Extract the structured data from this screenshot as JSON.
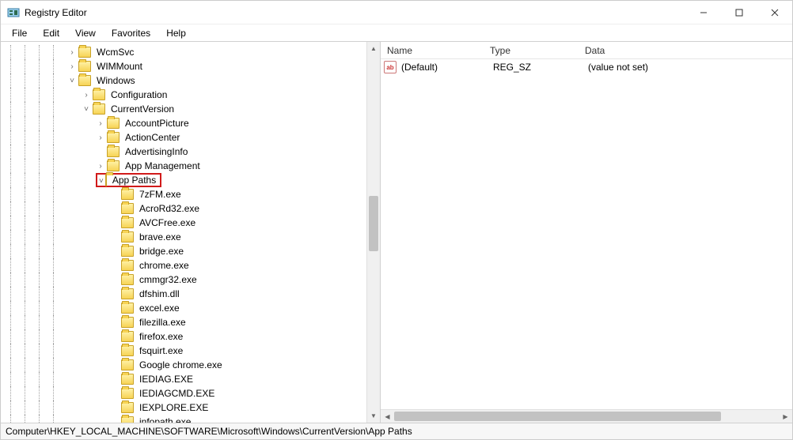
{
  "window": {
    "title": "Registry Editor"
  },
  "menu": {
    "items": [
      "File",
      "Edit",
      "View",
      "Favorites",
      "Help"
    ]
  },
  "tree": {
    "guide_offsets": [
      12,
      30,
      48,
      66
    ],
    "nodes": [
      {
        "indent": 84,
        "toggle": ">",
        "label": "WcmSvc"
      },
      {
        "indent": 84,
        "toggle": ">",
        "label": "WIMMount"
      },
      {
        "indent": 84,
        "toggle": "v",
        "label": "Windows"
      },
      {
        "indent": 102,
        "toggle": ">",
        "label": "Configuration"
      },
      {
        "indent": 102,
        "toggle": "v",
        "label": "CurrentVersion"
      },
      {
        "indent": 120,
        "toggle": ">",
        "label": "AccountPicture"
      },
      {
        "indent": 120,
        "toggle": ">",
        "label": "ActionCenter"
      },
      {
        "indent": 120,
        "toggle": "",
        "label": "AdvertisingInfo"
      },
      {
        "indent": 120,
        "toggle": ">",
        "label": "App Management"
      },
      {
        "indent": 120,
        "toggle": "v",
        "label": "App Paths",
        "highlight": true
      },
      {
        "indent": 138,
        "toggle": "",
        "label": "7zFM.exe"
      },
      {
        "indent": 138,
        "toggle": "",
        "label": "AcroRd32.exe"
      },
      {
        "indent": 138,
        "toggle": "",
        "label": "AVCFree.exe"
      },
      {
        "indent": 138,
        "toggle": "",
        "label": "brave.exe"
      },
      {
        "indent": 138,
        "toggle": "",
        "label": "bridge.exe"
      },
      {
        "indent": 138,
        "toggle": "",
        "label": "chrome.exe"
      },
      {
        "indent": 138,
        "toggle": "",
        "label": "cmmgr32.exe"
      },
      {
        "indent": 138,
        "toggle": "",
        "label": "dfshim.dll"
      },
      {
        "indent": 138,
        "toggle": "",
        "label": "excel.exe"
      },
      {
        "indent": 138,
        "toggle": "",
        "label": "filezilla.exe"
      },
      {
        "indent": 138,
        "toggle": "",
        "label": "firefox.exe"
      },
      {
        "indent": 138,
        "toggle": "",
        "label": "fsquirt.exe"
      },
      {
        "indent": 138,
        "toggle": "",
        "label": "Google chrome.exe"
      },
      {
        "indent": 138,
        "toggle": "",
        "label": "IEDIAG.EXE"
      },
      {
        "indent": 138,
        "toggle": "",
        "label": "IEDIAGCMD.EXE"
      },
      {
        "indent": 138,
        "toggle": "",
        "label": "IEXPLORE.EXE"
      },
      {
        "indent": 138,
        "toggle": "",
        "label": "infopath.exe"
      }
    ]
  },
  "list": {
    "columns": {
      "name": "Name",
      "type": "Type",
      "data": "Data"
    },
    "rows": [
      {
        "icon": "ab",
        "name": "(Default)",
        "type": "REG_SZ",
        "data": "(value not set)"
      }
    ]
  },
  "statusbar": {
    "path": "Computer\\HKEY_LOCAL_MACHINE\\SOFTWARE\\Microsoft\\Windows\\CurrentVersion\\App Paths"
  }
}
